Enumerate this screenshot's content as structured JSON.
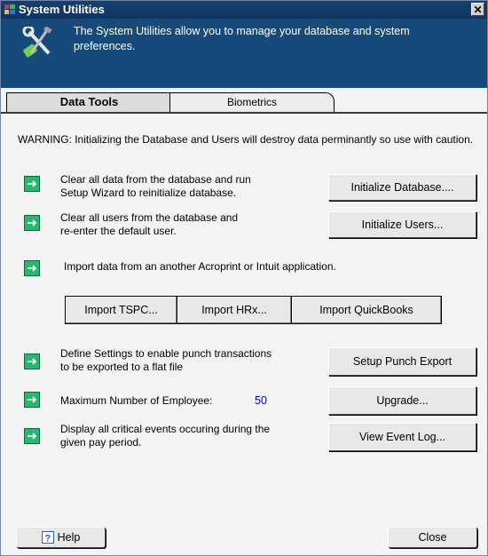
{
  "window": {
    "title": "System Utilities",
    "close_glyph": "✕",
    "description": "The System Utilities allow you to manage your database and system preferences."
  },
  "tabs": [
    {
      "label": "Data Tools",
      "active": true
    },
    {
      "label": "Biometrics",
      "active": false
    }
  ],
  "warning": "WARNING:  Initializing the Database and Users will destroy data perminantly so use with caution.",
  "rows": {
    "init_db": {
      "line1": "Clear all data from the database and run",
      "line2": "Setup Wizard to reinitialize database.",
      "button": "Initialize Database...."
    },
    "init_users": {
      "line1": "Clear all users from the  database and",
      "line2": "re-enter the default user.",
      "button": "Initialize Users..."
    },
    "import": {
      "text": "Import data from an another Acroprint or Intuit application.",
      "buttons": [
        "Import TSPC...",
        "Import HRx...",
        "Import QuickBooks"
      ]
    },
    "punch_export": {
      "line1": "Define Settings to enable punch transactions",
      "line2": "to be exported to a flat file",
      "button": "Setup Punch Export"
    },
    "max_employee": {
      "text": "Maximum Number of Employee:",
      "value": "50",
      "button": "Upgrade..."
    },
    "event_log": {
      "line1": "Display all critical events occuring during the",
      "line2": "given pay period.",
      "button": "View Event Log..."
    }
  },
  "footer": {
    "help_label": "Help",
    "close_label": "Close"
  },
  "colors": {
    "titlebar": "#0f3460",
    "header": "#154a7a",
    "arrow_fill": "#2bb56e",
    "number": "#0000c0"
  }
}
